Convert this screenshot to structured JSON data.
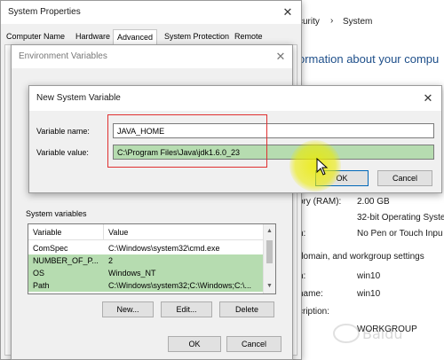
{
  "background_panel": {
    "breadcrumb_tail": "curity",
    "breadcrumb_sep": "›",
    "breadcrumb_current": "System",
    "heading": "ormation about your compu",
    "rows": [
      {
        "label": "ory (RAM):",
        "value": "2.00 GB"
      },
      {
        "label": "",
        "value": "32-bit Operating Syste"
      },
      {
        "label": "n:",
        "value": "No Pen or Touch Inpu"
      }
    ],
    "section_title": "domain, and workgroup settings",
    "rows2": [
      {
        "label": "n:",
        "value": "win10"
      },
      {
        "label": "name:",
        "value": "win10"
      },
      {
        "label": "cription:",
        "value": ""
      },
      {
        "label": "",
        "value": "WORKGROUP"
      }
    ]
  },
  "system_properties": {
    "title": "System Properties",
    "tabs": [
      "Computer Name",
      "Hardware",
      "Advanced",
      "System Protection",
      "Remote"
    ],
    "active_tab": "Advanced"
  },
  "env_vars": {
    "title": "Environment Variables",
    "system_variables_label": "System variables",
    "columns": [
      "Variable",
      "Value"
    ],
    "rows": [
      {
        "variable": "ComSpec",
        "value": "C:\\Windows\\system32\\cmd.exe"
      },
      {
        "variable": "NUMBER_OF_P...",
        "value": "2"
      },
      {
        "variable": "OS",
        "value": "Windows_NT"
      },
      {
        "variable": "Path",
        "value": "C:\\Windows\\system32;C:\\Windows;C:\\..."
      }
    ],
    "buttons": {
      "new": "New...",
      "edit": "Edit...",
      "delete": "Delete"
    },
    "ok": "OK",
    "cancel": "Cancel"
  },
  "new_var": {
    "title": "New System Variable",
    "name_label": "Variable name:",
    "value_label": "Variable value:",
    "name_value": "JAVA_HOME",
    "value_value": "C:\\Program Files\\Java\\jdk1.6.0_23",
    "ok": "OK",
    "cancel": "Cancel"
  },
  "colors": {
    "accent": "#0067b8",
    "highlight_box": "#e03030",
    "cursor_glow": "#e6e600",
    "selected_row": "#b6dcb0"
  }
}
